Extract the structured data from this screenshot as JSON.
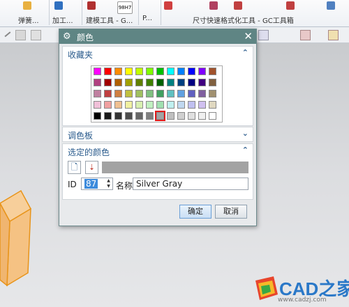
{
  "ribbon": {
    "groups": [
      "弹簧...",
      "加工...",
      "建模工具 - G...",
      "P...",
      "尺寸快速格式化工具 - GC工具箱"
    ],
    "center_icon_text": "98H7"
  },
  "dialog": {
    "title": "颜色",
    "title_icon": "gear-icon",
    "close_glyph": "✕",
    "favorites": {
      "title": "收藏夹",
      "chevron": "⌃",
      "swatches": [
        [
          "#ff00ff",
          "#ff0000",
          "#ff8c00",
          "#ffff00",
          "#c0ff00",
          "#80ff00",
          "#00c000",
          "#00ffff",
          "#0080ff",
          "#0000ff",
          "#8000ff",
          "#a0522d"
        ],
        [
          "#b04080",
          "#a00000",
          "#b06000",
          "#a0a000",
          "#608000",
          "#408000",
          "#006000",
          "#008080",
          "#004080",
          "#000080",
          "#400080",
          "#806040"
        ],
        [
          "#c080a0",
          "#c04040",
          "#d08040",
          "#c0c040",
          "#a0c060",
          "#80c080",
          "#40a060",
          "#60c0c0",
          "#60a0e0",
          "#6060c0",
          "#8060a0",
          "#a09070"
        ],
        [
          "#f0c0d8",
          "#f0a0a0",
          "#f0c090",
          "#f0f0a0",
          "#d8f0b0",
          "#c0f0c0",
          "#a0e0b0",
          "#c0f0f0",
          "#c0d8f0",
          "#c0c0f0",
          "#d0c0f0",
          "#e0d8c0"
        ],
        [
          "#000000",
          "#1a1a1a",
          "#333333",
          "#4d4d4d",
          "#666666",
          "#808080",
          "#a3a3a3",
          "#bfbfbf",
          "#d0d0d0",
          "#e0e0e0",
          "#f0f0f0",
          "#ffffff"
        ]
      ],
      "selected_row": 4,
      "selected_col": 6
    },
    "palette": {
      "title": "调色板",
      "chevron": "⌄"
    },
    "selected_color": {
      "title": "选定的颜色",
      "chevron": "⌃",
      "preview_color": "#a3a3a3",
      "id_label": "ID",
      "id_value": "87",
      "name_label": "名称",
      "name_value": "Silver Gray"
    },
    "buttons": {
      "ok": "确定",
      "cancel": "取消"
    }
  },
  "watermark": {
    "text": "CAD之家",
    "url": "www.cadzj.com"
  },
  "colors": {
    "dialog_title_bar": "#5f8584",
    "section_title": "#2a5b8c",
    "box_fill": "#f5c283",
    "box_edge": "#e8941a"
  }
}
